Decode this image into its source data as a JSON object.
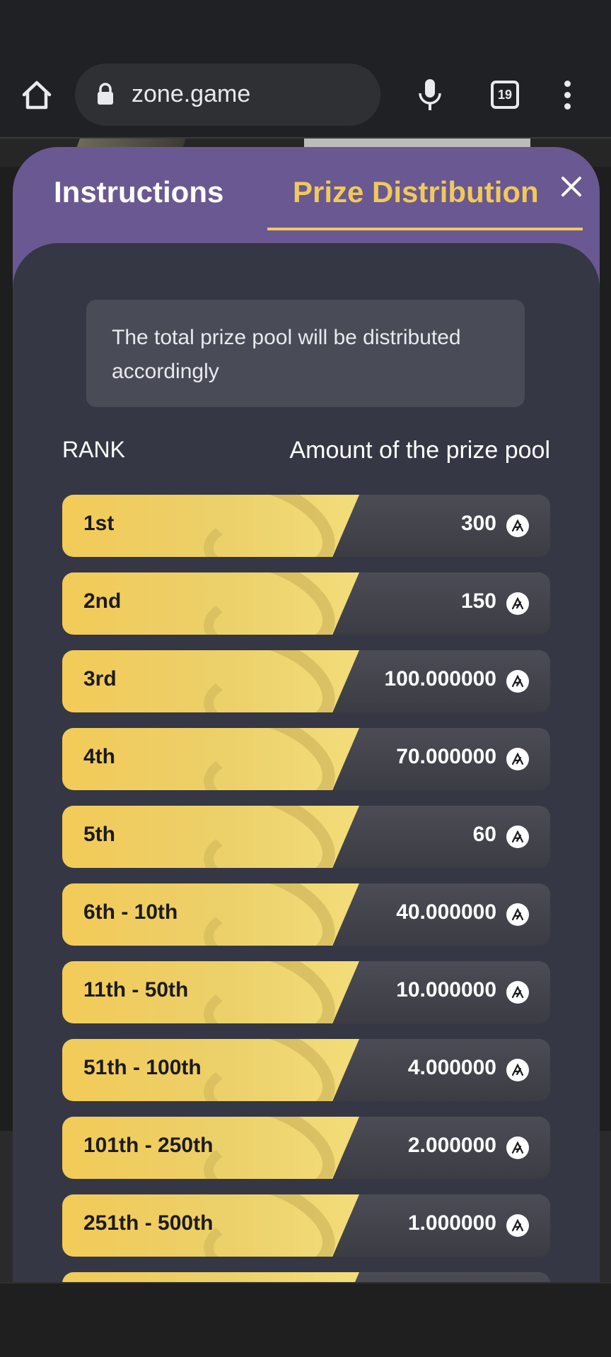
{
  "browser": {
    "url": "zone.game",
    "tab_count": "19"
  },
  "modal": {
    "tabs": [
      {
        "label": "Instructions",
        "active": false
      },
      {
        "label": "Prize Distribution",
        "active": true
      }
    ],
    "info_text": "The total prize pool will be distributed accordingly",
    "columns": {
      "rank": "RANK",
      "amount": "Amount of the prize pool"
    },
    "rows": [
      {
        "rank": "1st",
        "amount": "300"
      },
      {
        "rank": "2nd",
        "amount": "150"
      },
      {
        "rank": "3rd",
        "amount": "100.000000"
      },
      {
        "rank": "4th",
        "amount": "70.000000"
      },
      {
        "rank": "5th",
        "amount": "60"
      },
      {
        "rank": "6th - 10th",
        "amount": "40.000000"
      },
      {
        "rank": "11th - 50th",
        "amount": "10.000000"
      },
      {
        "rank": "51th - 100th",
        "amount": "4.000000"
      },
      {
        "rank": "101th - 250th",
        "amount": "2.000000"
      },
      {
        "rank": "251th - 500th",
        "amount": "1.000000"
      }
    ]
  },
  "colors": {
    "modal_purple": "#6a5892",
    "panel": "#353744",
    "accent_gold": "#f0c95a"
  },
  "icons": {
    "token": "aptos-token-icon",
    "close": "close-icon",
    "home": "home-icon",
    "lock": "lock-icon",
    "mic": "mic-icon",
    "menu": "more-vert-icon"
  }
}
